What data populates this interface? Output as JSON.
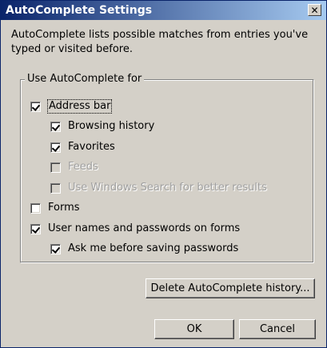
{
  "window": {
    "title": "AutoComplete Settings",
    "close_glyph": "✕"
  },
  "description": "AutoComplete lists possible matches from entries you've typed or visited before.",
  "group_label": "Use AutoComplete for",
  "options": {
    "address_bar": {
      "label": "Address bar",
      "checked": true,
      "enabled": true
    },
    "browsing_history": {
      "label": "Browsing history",
      "checked": true,
      "enabled": true
    },
    "favorites": {
      "label": "Favorites",
      "checked": true,
      "enabled": true
    },
    "feeds": {
      "label": "Feeds",
      "checked": false,
      "enabled": false
    },
    "windows_search": {
      "label": "Use Windows Search for better results",
      "checked": false,
      "enabled": false
    },
    "forms": {
      "label": "Forms",
      "checked": false,
      "enabled": true
    },
    "usernames_passwords": {
      "label": "User names and passwords on forms",
      "checked": true,
      "enabled": true
    },
    "ask_before_saving": {
      "label": "Ask me before saving passwords",
      "checked": true,
      "enabled": true
    }
  },
  "buttons": {
    "delete_history": "Delete AutoComplete history...",
    "ok": "OK",
    "cancel": "Cancel"
  }
}
